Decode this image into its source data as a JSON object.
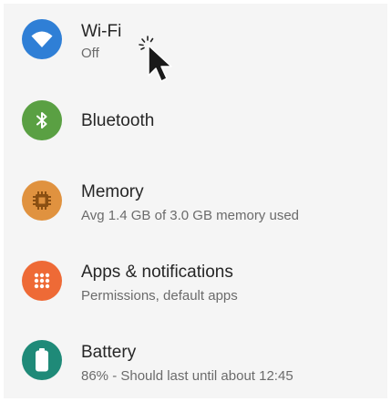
{
  "colors": {
    "panel_background": "#f5f5f5",
    "title_text": "#262626",
    "subtitle_text": "#6b6b6b",
    "wifi": "#2f7fd6",
    "bluetooth": "#5aa043",
    "memory": "#e0923f",
    "apps": "#ee6a36",
    "battery": "#1f8a78"
  },
  "settings": {
    "items": [
      {
        "id": "wifi",
        "icon": "wifi-icon",
        "title": "Wi-Fi",
        "subtitle": "Off"
      },
      {
        "id": "bluetooth",
        "icon": "bluetooth-icon",
        "title": "Bluetooth",
        "subtitle": ""
      },
      {
        "id": "memory",
        "icon": "memory-chip-icon",
        "title": "Memory",
        "subtitle": "Avg 1.4 GB of 3.0 GB memory used"
      },
      {
        "id": "apps",
        "icon": "apps-grid-icon",
        "title": "Apps & notifications",
        "subtitle": "Permissions, default apps"
      },
      {
        "id": "battery",
        "icon": "battery-icon",
        "title": "Battery",
        "subtitle": "86% - Should last until about 12:45"
      }
    ]
  },
  "cursor": {
    "icon": "pointer-arrow-icon"
  }
}
